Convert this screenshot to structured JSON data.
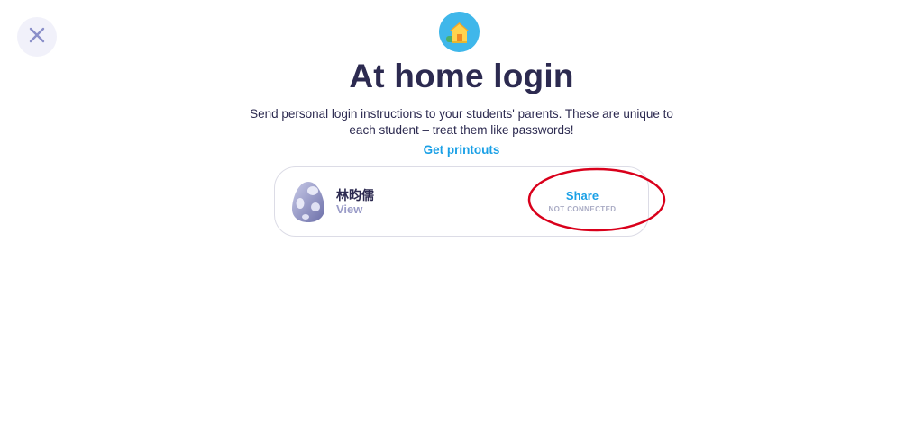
{
  "header": {
    "title": "At home login",
    "subtitle": "Send personal login instructions to your students' parents. These are unique to each student – treat them like passwords!",
    "printouts_link": "Get printouts"
  },
  "icons": {
    "close": "close-icon",
    "home": "house-icon",
    "avatar": "egg-icon"
  },
  "students": [
    {
      "name": "林昀儒",
      "view_label": "View",
      "share_label": "Share",
      "share_status": "NOT CONNECTED"
    }
  ],
  "colors": {
    "title": "#2c2a50",
    "link": "#1aa0e6",
    "muted": "#9a9cc8",
    "icon_bg": "#3fb7ea",
    "close_bg": "#f1f1fa",
    "annotation": "#d9001b"
  }
}
